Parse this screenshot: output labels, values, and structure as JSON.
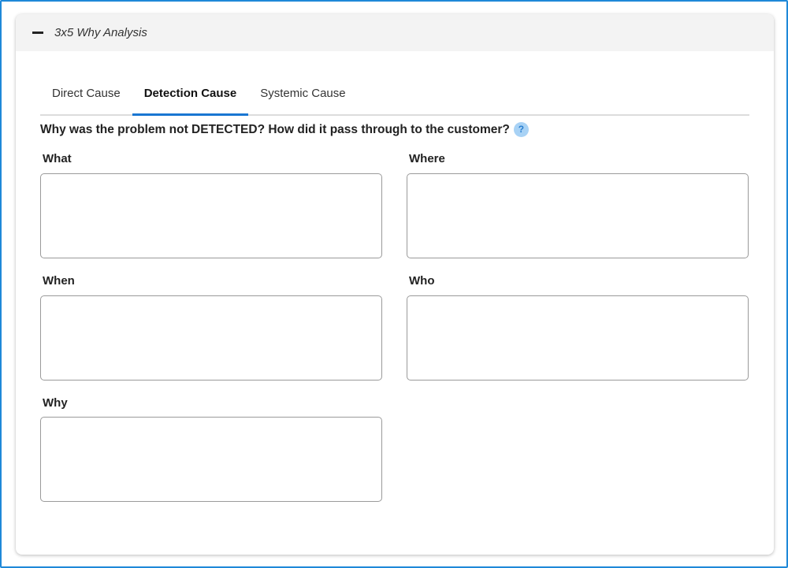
{
  "panel": {
    "title": "3x5 Why Analysis"
  },
  "tabs": [
    {
      "label": "Direct Cause",
      "active": false
    },
    {
      "label": "Detection Cause",
      "active": true
    },
    {
      "label": "Systemic Cause",
      "active": false
    }
  ],
  "question": {
    "text": "Why was the problem not DETECTED? How did it pass through to the customer?",
    "help_glyph": "?"
  },
  "fields": {
    "what": {
      "label": "What",
      "value": ""
    },
    "where": {
      "label": "Where",
      "value": ""
    },
    "when": {
      "label": "When",
      "value": ""
    },
    "who": {
      "label": "Who",
      "value": ""
    },
    "why": {
      "label": "Why",
      "value": ""
    }
  },
  "colors": {
    "frame_border": "#1e88d8",
    "active_tab_underline": "#1976d2",
    "help_icon_bg": "#a8d2f5"
  }
}
